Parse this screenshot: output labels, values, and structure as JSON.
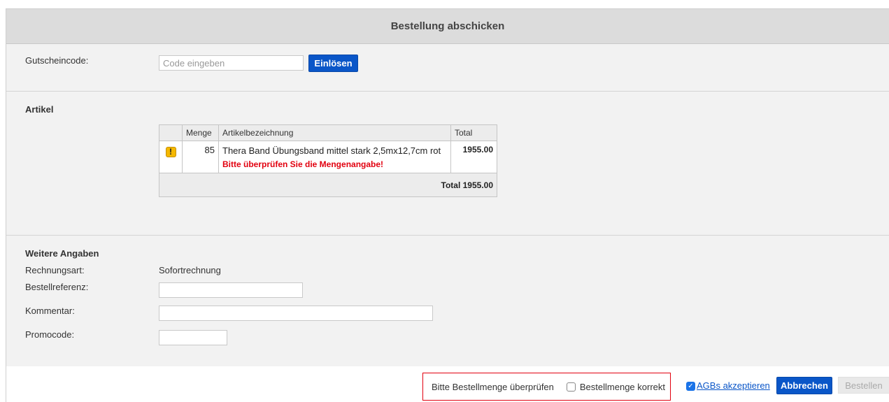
{
  "header": {
    "title": "Bestellung abschicken"
  },
  "voucher": {
    "label": "Gutscheincode:",
    "placeholder": "Code eingeben",
    "redeem_label": "Einlösen"
  },
  "articles": {
    "section_title": "Artikel",
    "columns": [
      "",
      "Menge",
      "Artikelbezeichnung",
      "Total"
    ],
    "rows": [
      {
        "icon": "warning-icon",
        "quantity": "85",
        "name": "Thera Band Übungsband mittel stark 2,5mx12,7cm rot",
        "warning": "Bitte überprüfen Sie die Mengenangabe!",
        "total": "1955.00"
      }
    ],
    "footer_total": "Total 1955.00"
  },
  "more": {
    "section_title": "Weitere Angaben",
    "invoice_label": "Rechnungsart:",
    "invoice_value": "Sofortrechnung",
    "reference_label": "Bestellreferenz:",
    "reference_value": "",
    "comment_label": "Kommentar:",
    "comment_value": "",
    "promo_label": "Promocode:",
    "promo_value": ""
  },
  "footer": {
    "check_hint": "Bitte Bestellmenge überprüfen",
    "check_label": "Bestellmenge korrekt",
    "check_checked": false,
    "agb_label": "AGBs akzeptieren",
    "agb_checked": true,
    "cancel_label": "Abbrechen",
    "order_label": "Bestellen"
  },
  "colors": {
    "primary": "#0a56c8",
    "warning_text": "#e2000f",
    "warning_icon": "#f5b800"
  }
}
